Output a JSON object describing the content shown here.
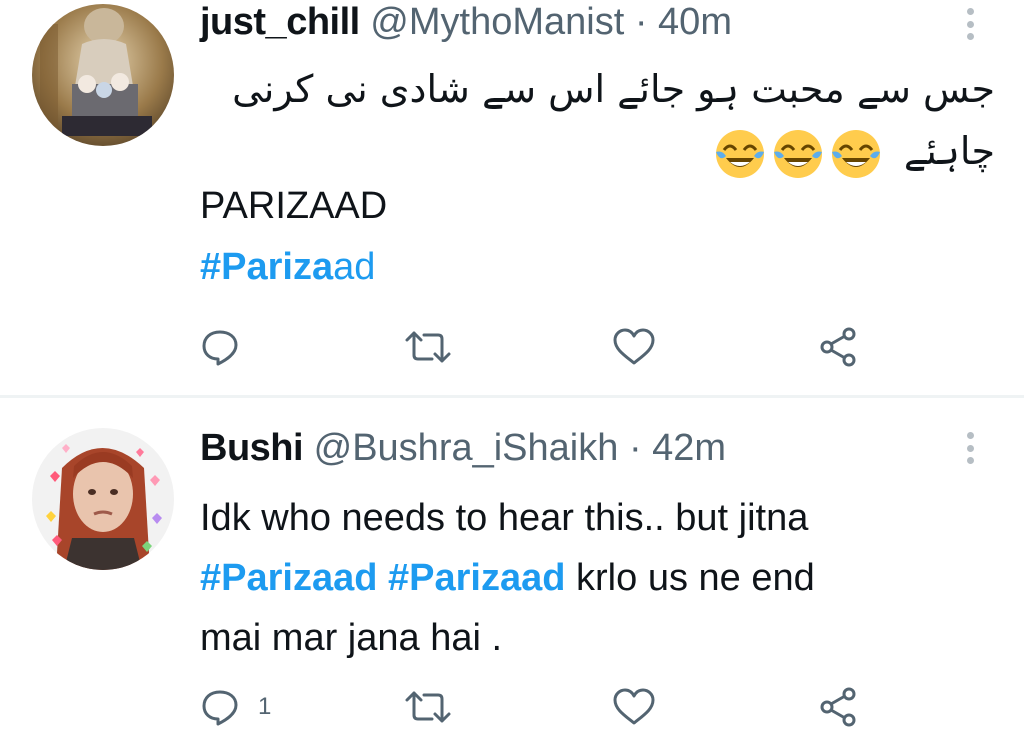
{
  "tweets": [
    {
      "name": "just_chill",
      "handle": "@MythoManist",
      "separator": "·",
      "time": "40m",
      "text_urdu": "جس سے محبت ہو جائے اس سے شادی نی کرنی چاہئے",
      "emoji": [
        "face-with-tears-of-joy",
        "face-with-tears-of-joy",
        "face-with-tears-of-joy"
      ],
      "line2": "PARIZAAD",
      "hashtag_bold": "#Pariza",
      "hashtag_tail": "ad",
      "reply_count": "",
      "retweet_count": "",
      "like_count": ""
    },
    {
      "name": "Bushi",
      "handle": "@Bushra_iShaikh",
      "separator": "·",
      "time": "42m",
      "text_line1": "Idk who needs to hear this.. but jitna",
      "hashtag1": "#Parizaad",
      "hashtag2": "#Parizaad",
      "text_line2_rest": "krlo us ne end",
      "text_line3": "mai mar jana hai .",
      "reply_count": "1",
      "retweet_count": "",
      "like_count": ""
    }
  ],
  "colors": {
    "text": "#0f1419",
    "secondary": "#536471",
    "hashtag": "#1d9bf0",
    "divider": "#eff3f4",
    "more_dots": "#b6bec4"
  },
  "icons": [
    "reply-icon",
    "retweet-icon",
    "like-icon",
    "share-icon",
    "more-icon"
  ]
}
